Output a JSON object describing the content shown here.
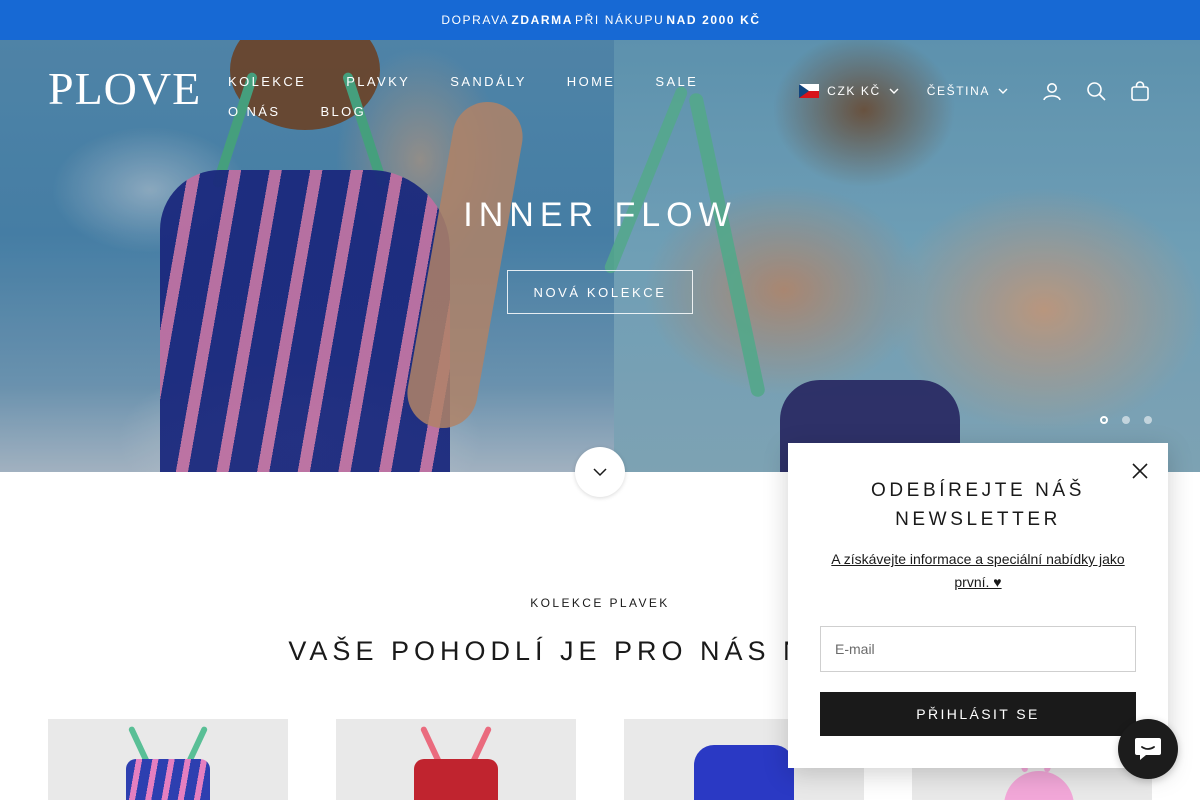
{
  "announcement": {
    "part1": "DOPRAVA",
    "part2": "ZDARMA",
    "part3": "PŘI NÁKUPU",
    "part4": "NAD 2000 KČ"
  },
  "header": {
    "logo": "PLOVE",
    "nav": [
      "KOLEKCE",
      "PLAVKY",
      "SANDÁLY",
      "HOME",
      "SALE",
      "O NÁS",
      "BLOG"
    ],
    "currency": "CZK KČ",
    "language": "ČEŠTINA",
    "icons": [
      "account-icon",
      "search-icon",
      "cart-icon"
    ]
  },
  "hero": {
    "title": "INNER FLOW",
    "button": "NOVÁ KOLEKCE",
    "slides": 3,
    "active_slide": 1
  },
  "section": {
    "eyebrow": "KOLEKCE PLAVEK",
    "title": "VAŠE POHODLÍ JE PRO NÁS NA PRV"
  },
  "newsletter": {
    "title": "ODEBÍREJTE NÁŠ NEWSLETTER",
    "text": "A získávejte informace a speciální nabídky jako první. ♥",
    "email_placeholder": "E-mail",
    "submit": "PŘIHLÁSIT SE"
  },
  "colors": {
    "announcement_bg": "#1769d4",
    "dark": "#1a1a1a",
    "tile_bg": "#e9e9e9"
  }
}
